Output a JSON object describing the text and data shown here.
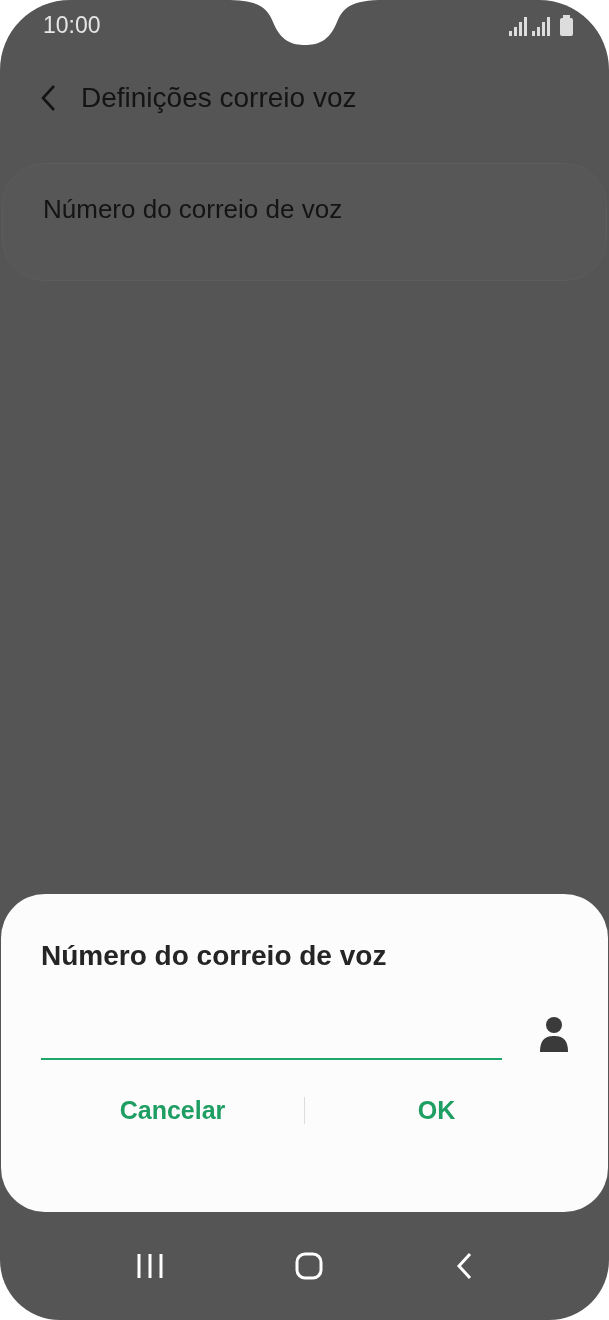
{
  "status_bar": {
    "time": "10:00"
  },
  "header": {
    "title": "Definições correio voz"
  },
  "settings_items": [
    {
      "label": "Número do correio de voz"
    }
  ],
  "dialog": {
    "title": "Número do correio de voz",
    "input": {
      "focused": true
    },
    "buttons": [
      {
        "label": "Cancelar"
      },
      {
        "label": "OK"
      }
    ]
  }
}
